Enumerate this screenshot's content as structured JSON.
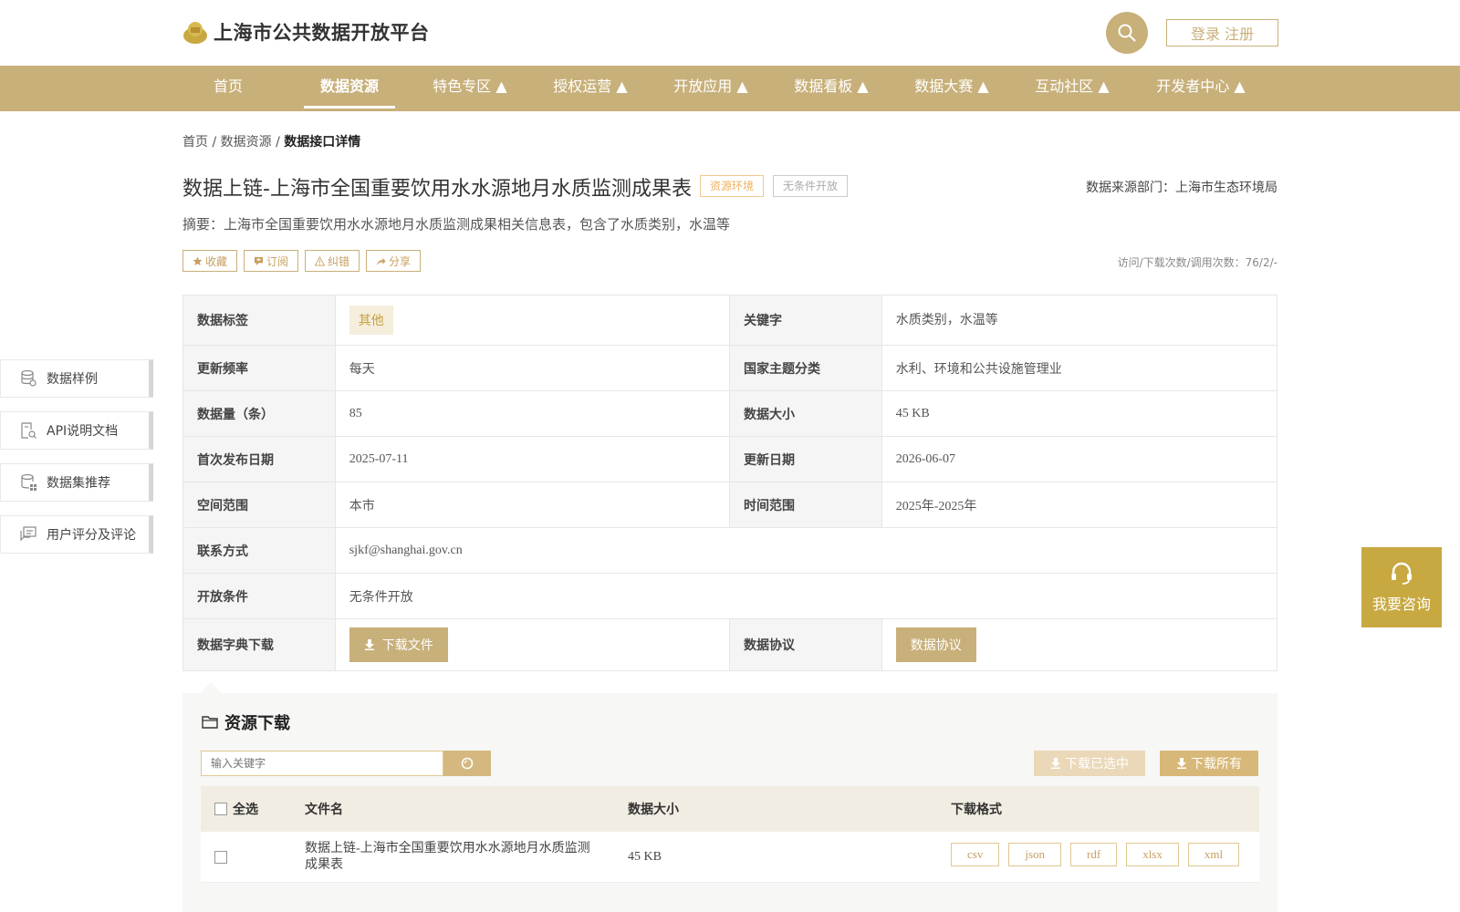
{
  "header": {
    "site_title": "上海市公共数据开放平台",
    "login_label": "登录 注册"
  },
  "nav": {
    "items": [
      {
        "label": "首页"
      },
      {
        "label": "数据资源"
      },
      {
        "label": "特色专区 ▲"
      },
      {
        "label": "授权运营 ▲"
      },
      {
        "label": "开放应用 ▲"
      },
      {
        "label": "数据看板 ▲"
      },
      {
        "label": "数据大赛 ▲"
      },
      {
        "label": "互动社区 ▲"
      },
      {
        "label": "开发者中心 ▲"
      }
    ]
  },
  "breadcrumb": {
    "home": "首页",
    "sep1": " / ",
    "resources": "数据资源",
    "sep2": " / ",
    "current": "数据接口详情"
  },
  "dataset": {
    "title": "数据上链-上海市全国重要饮用水水源地月水质监测成果表",
    "tag_env": "资源环境",
    "tag_open": "无条件开放",
    "source_dept": "数据来源部门：上海市生态环境局",
    "summary": "摘要：上海市全国重要饮用水水源地月水质监测成果相关信息表，包含了水质类别，水温等",
    "stats": "访问/下载次数/调用次数：76/2/-"
  },
  "actions": {
    "favorite": "收藏",
    "subscribe": "订阅",
    "report": "纠错",
    "share": "分享"
  },
  "info": {
    "tag_label": "数据标签",
    "tag_value": "其他",
    "keyword_label": "关键字",
    "keyword_value": "水质类别，水温等",
    "freq_label": "更新频率",
    "freq_value": "每天",
    "theme_label": "国家主题分类",
    "theme_value": "水利、环境和公共设施管理业",
    "count_label": "数据量（条）",
    "count_value": "85",
    "size_label": "数据大小",
    "size_value": "45 KB",
    "first_pub_label": "首次发布日期",
    "first_pub_value": "2025-07-11",
    "update_label": "更新日期",
    "update_value": "2026-06-07",
    "space_label": "空间范围",
    "space_value": "本市",
    "time_label": "时间范围",
    "time_value": "2025年-2025年",
    "contact_label": "联系方式",
    "contact_value": "sjkf@shanghai.gov.cn",
    "open_label": "开放条件",
    "open_value": "无条件开放",
    "dict_label": "数据字典下载",
    "dict_button": "下载文件",
    "agreement_label": "数据协议",
    "agreement_button": "数据协议"
  },
  "sidebar": {
    "items": [
      {
        "label": "数据样例"
      },
      {
        "label": "API说明文档"
      },
      {
        "label": "数据集推荐"
      },
      {
        "label": "用户评分及评论"
      }
    ]
  },
  "consult": {
    "label": "我要咨询"
  },
  "resource": {
    "title": "资源下载",
    "search_placeholder": "输入关键字",
    "download_selected": "下载已选中",
    "download_all": "下载所有",
    "columns": {
      "select_all": "全选",
      "filename": "文件名",
      "size": "数据大小",
      "format": "下载格式"
    },
    "rows": [
      {
        "filename_line1": "数据上链-上海市全国重要饮用水水源地月水质监测",
        "filename_line2": "成果表",
        "size": "45 KB",
        "formats": [
          "csv",
          "json",
          "rdf",
          "xlsx",
          "xml"
        ]
      }
    ]
  },
  "colors": {
    "brand_gold": "#c8b07a",
    "consult_gold": "#c8a840"
  }
}
